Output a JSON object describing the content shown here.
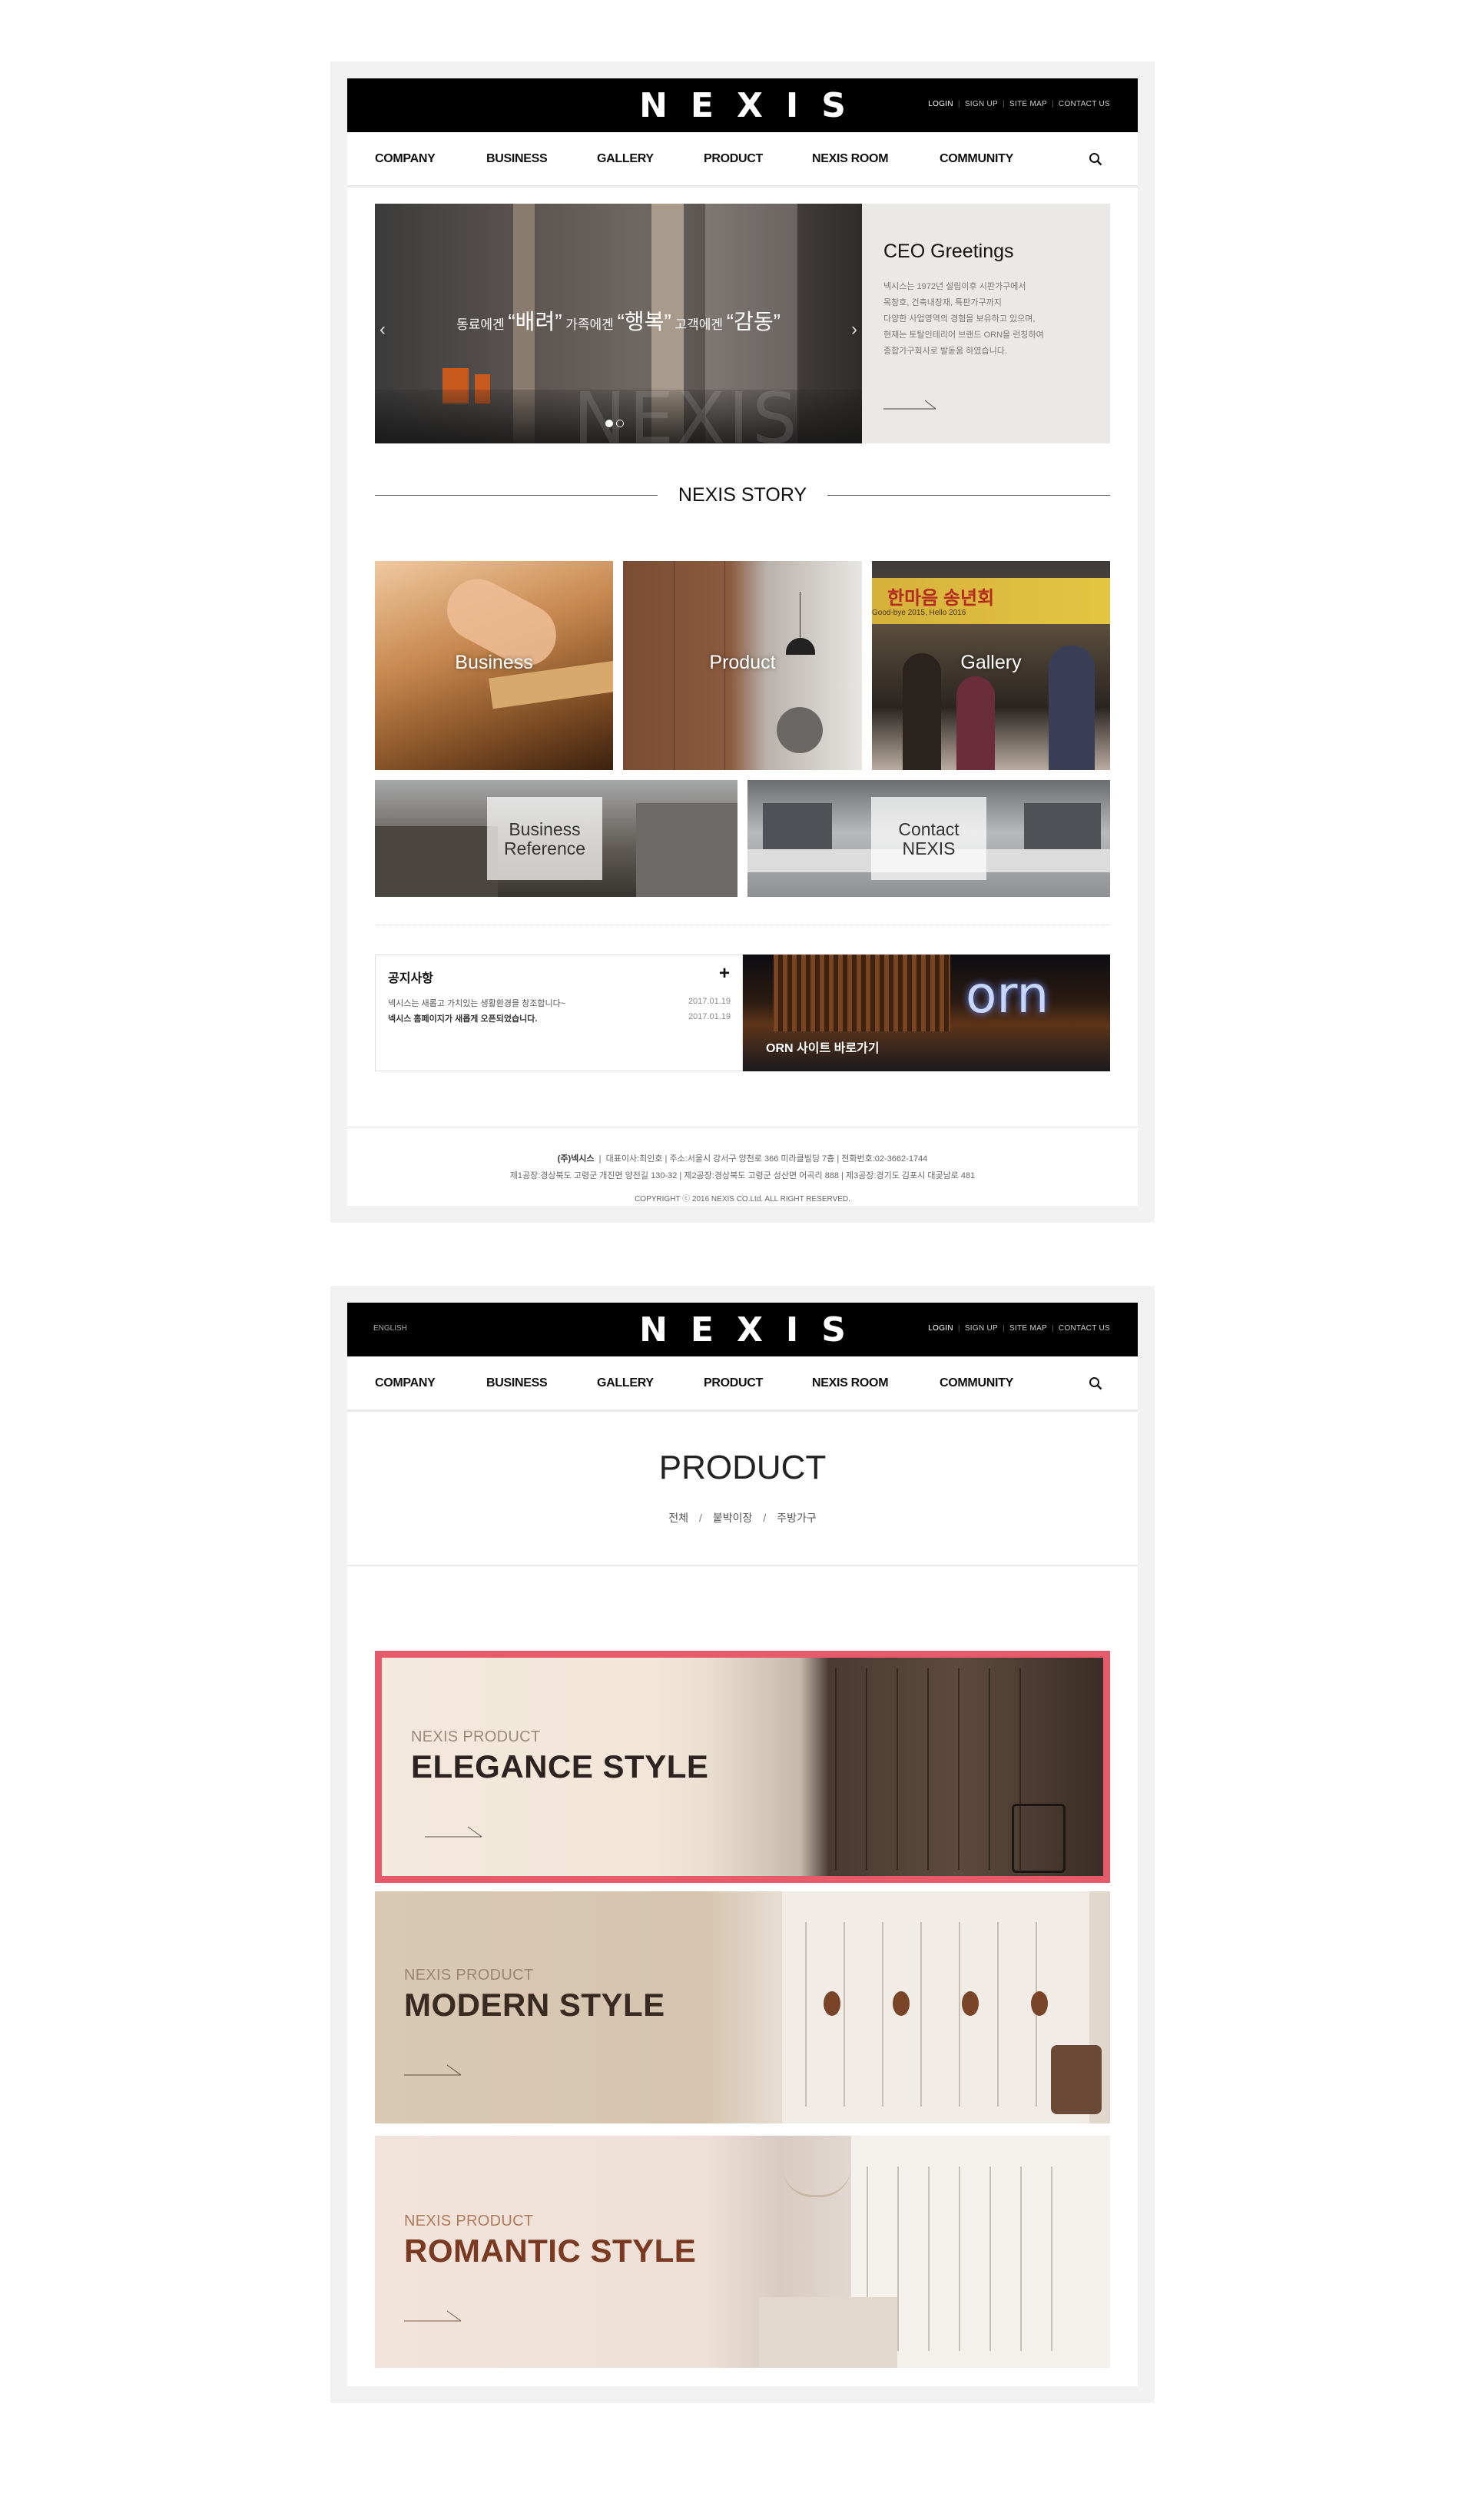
{
  "colors": {
    "header_bg": "#000000",
    "accent_border": "#e65b6c",
    "elegance_text": "#2d2320",
    "modern_text": "#3a2b22",
    "romantic_text": "#7a3a22"
  },
  "header": {
    "logo": "NEXIS",
    "lang": "ENGLISH",
    "util": [
      "LOGIN",
      "SIGN UP",
      "SITE MAP",
      "CONTACT US"
    ]
  },
  "nav": {
    "items": [
      "COMPANY",
      "BUSINESS",
      "GALLERY",
      "PRODUCT",
      "NEXIS ROOM",
      "COMMUNITY"
    ],
    "search_icon": "search-icon"
  },
  "main_page": {
    "hero": {
      "t1": "동료에겐",
      "q1": "“배려”",
      "t2": "가족에겐",
      "q2": "“행복”",
      "t3": "고객에겐",
      "q3": "“감동”",
      "watermark": "NEXIS",
      "slides": 2,
      "active_slide": 1
    },
    "ceo": {
      "title": "CEO Greetings",
      "lines": [
        "넥시스는 1972년 설립이후 시판가구에서",
        "목창호, 건축내장재, 특판가구까지",
        "다양한 사업영역의 경험을 보유하고 있으며,",
        "현재는 토탈인테리어 브랜드 ORN을 런칭하여",
        "종합가구회사로 발돋움 하였습니다."
      ]
    },
    "story": {
      "title": "NEXIS STORY",
      "tiles": {
        "business": "Business",
        "product": "Product",
        "gallery": "Gallery",
        "gallery_banner": "한마음 송년회",
        "gallery_banner_sub": "Good-bye 2015, Hello 2016",
        "reference_l1": "Business",
        "reference_l2": "Reference",
        "contact_l1": "Contact",
        "contact_l2": "NEXIS"
      }
    },
    "notice": {
      "title": "공지사항",
      "rows": [
        {
          "text": "넥시스는 새롭고 가치있는 생활환경을 창조합니다~",
          "date": "2017.01.19"
        },
        {
          "text": "넥시스 홈페이지가 새롭게 오픈되었습니다.",
          "date": "2017.01.19"
        }
      ]
    },
    "orn": {
      "logo": "orn",
      "caption": "ORN 사이트 바로가기"
    },
    "footer": {
      "company": "(주)넥시스",
      "line1_rest": "대표이사:최인호  |  주소:서울시 강서구 양천로 366 미라클빌딩 7층  |  전화번호:02-3662-1744",
      "line2": "제1공장:경상북도 고령군 개진면 양전길 130-32  |  제2공장:경상북도 고령군 성산면 어곡리 888  |  제3공장:경기도 김포시 대곶남로 481",
      "copyright": "COPYRIGHT ⓒ 2016 NEXIS CO.Ltd. ALL RIGHT RESERVED."
    }
  },
  "product_page": {
    "title": "PRODUCT",
    "categories": [
      "전체",
      "붙박이장",
      "주방가구"
    ],
    "cards": [
      {
        "sub": "NEXIS PRODUCT",
        "title": "ELEGANCE STYLE"
      },
      {
        "sub": "NEXIS PRODUCT",
        "title": "MODERN STYLE"
      },
      {
        "sub": "NEXIS PRODUCT",
        "title": "ROMANTIC STYLE"
      }
    ]
  }
}
